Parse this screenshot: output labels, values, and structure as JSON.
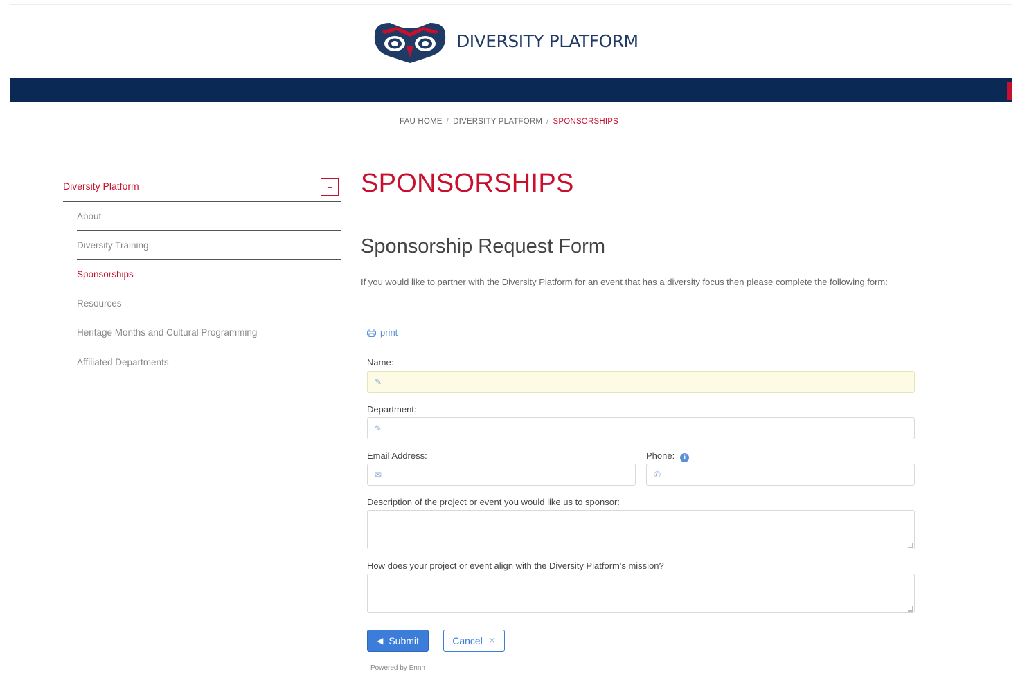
{
  "brand": {
    "site_title": "DIVERSITY PLATFORM",
    "logo_icon": "owl-logo-icon",
    "colors": {
      "navy": "#0a2a55",
      "red": "#c8102e",
      "link_blue": "#3b7dd8"
    }
  },
  "breadcrumb": {
    "items": [
      "FAU HOME",
      "DIVERSITY PLATFORM",
      "SPONSORSHIPS"
    ],
    "separator": "/"
  },
  "sidebar": {
    "heading": "Diversity Platform",
    "toggle_symbol": "−",
    "items": [
      {
        "label": "About"
      },
      {
        "label": "Diversity Training"
      },
      {
        "label": "Sponsorships",
        "active": true
      },
      {
        "label": "Resources"
      },
      {
        "label": "Heritage Months and Cultural Programming"
      },
      {
        "label": "Affiliated Departments"
      }
    ]
  },
  "main": {
    "page_title": "SPONSORSHIPS",
    "form_title": "Sponsorship Request Form",
    "intro": "If you would like to partner with the Diversity Platform for an event that has a diversity focus then please complete the following form:",
    "print_label": "print"
  },
  "form": {
    "name_label": "Name:",
    "department_label": "Department:",
    "email_label": "Email Address:",
    "phone_label": "Phone:",
    "description_label": "Description of the project or event you would like us to sponsor:",
    "mission_label": "How does your project or event align with the Diversity Platform's mission?",
    "name_value": "",
    "department_value": "",
    "email_value": "",
    "phone_value": "",
    "submit_label": "Submit",
    "cancel_label": "Cancel",
    "powered_prefix": "Powered by",
    "powered_link": "Ennn"
  }
}
